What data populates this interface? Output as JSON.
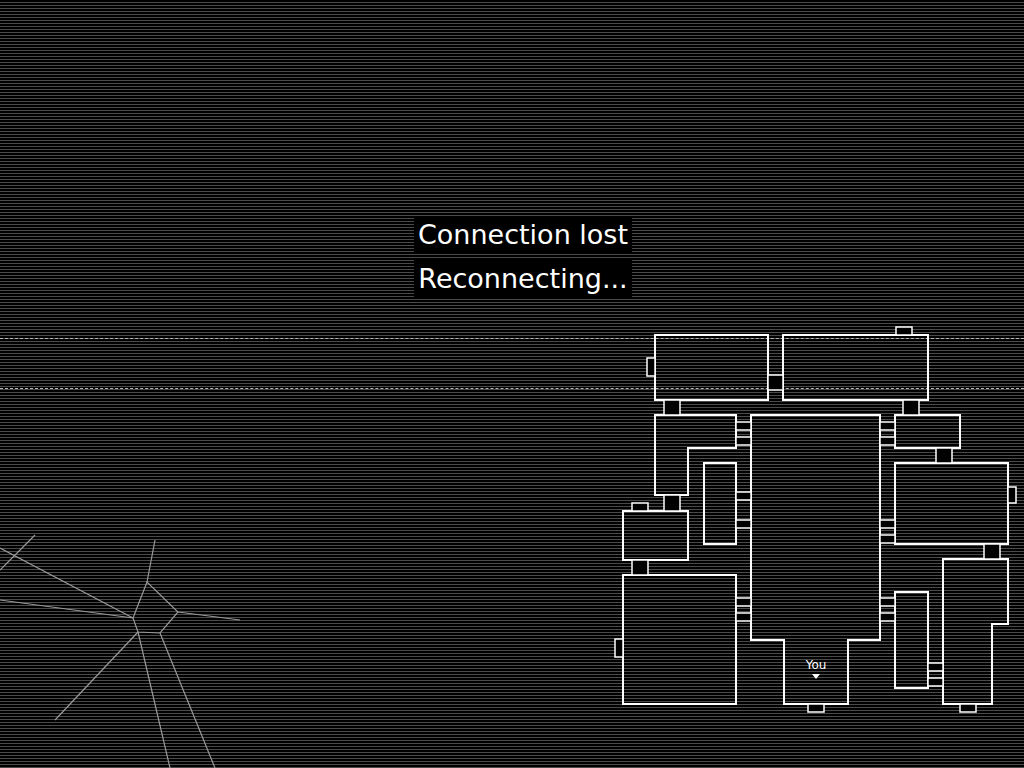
{
  "status": {
    "title": "Connection lost",
    "subtitle": "Reconnecting..."
  },
  "map": {
    "player_label": "You"
  }
}
